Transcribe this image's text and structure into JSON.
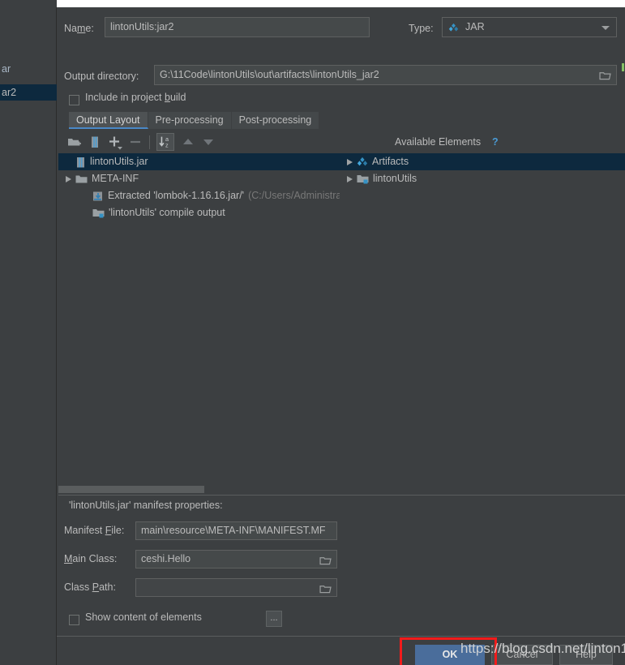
{
  "left_pane": {
    "items": [
      {
        "label": "ar",
        "selected": false
      },
      {
        "label": "ar2",
        "selected": true
      }
    ]
  },
  "form": {
    "name_label": "Name:",
    "name_value": "lintonUtils:jar2",
    "type_label": "Type:",
    "type_value": "JAR",
    "type_icon": "artifact-diamond-icon",
    "output_dir_label": "Output directory:",
    "output_dir_value": "G:\\11Code\\lintonUtils\\out\\artifacts\\lintonUtils_jar2",
    "include_in_build_label": "Include in project build",
    "include_in_build_checked": false
  },
  "tabs": [
    {
      "label": "Output Layout",
      "active": true
    },
    {
      "label": "Pre-processing",
      "active": false
    },
    {
      "label": "Post-processing",
      "active": false
    }
  ],
  "toolbar": {
    "buttons": [
      {
        "name": "add-directory-icon",
        "enabled": true
      },
      {
        "name": "add-archive-icon",
        "enabled": true
      },
      {
        "name": "add-plus-dropdown-icon",
        "enabled": true
      },
      {
        "name": "remove-minus-icon",
        "enabled": false
      },
      {
        "name": "sort-alphabetically-icon",
        "enabled": true,
        "boxed": true
      },
      {
        "name": "move-up-icon",
        "enabled": false
      },
      {
        "name": "move-down-icon",
        "enabled": false
      }
    ]
  },
  "available_elements": {
    "title": "Available Elements",
    "help_glyph": "?"
  },
  "output_tree": [
    {
      "label": "lintonUtils.jar",
      "sub": "",
      "indent": 0,
      "icon": "jar-archive-icon",
      "arrow": false,
      "selected": true
    },
    {
      "label": "META-INF",
      "sub": "",
      "indent": 0,
      "icon": "folder-icon",
      "arrow": true,
      "selected": false
    },
    {
      "label": "Extracted 'lombok-1.16.16.jar/'",
      "sub": "(C:/Users/Administrat",
      "indent": 1,
      "icon": "extracted-archive-icon",
      "arrow": false,
      "selected": false
    },
    {
      "label": "'lintonUtils' compile output",
      "sub": "",
      "indent": 1,
      "icon": "module-output-icon",
      "arrow": false,
      "selected": false
    }
  ],
  "available_tree": [
    {
      "label": "Artifacts",
      "indent": 0,
      "icon": "artifact-diamond-icon",
      "arrow": true,
      "selected": true
    },
    {
      "label": "lintonUtils",
      "indent": 0,
      "icon": "module-output-icon",
      "arrow": true,
      "selected": false
    }
  ],
  "manifest": {
    "title": "'lintonUtils.jar' manifest properties:",
    "fields": [
      {
        "label": "Manifest File:",
        "value": "main\\resource\\META-INF\\MANIFEST.MF",
        "has_browse": false
      },
      {
        "label": "Main Class:",
        "value": "ceshi.Hello",
        "has_browse": true
      },
      {
        "label": "Class Path:",
        "value": "",
        "has_browse": true
      }
    ],
    "show_content_label": "Show content of elements",
    "show_content_checked": false,
    "ellipsis_label": "..."
  },
  "buttons": {
    "ok": "OK",
    "cancel": "Cancel",
    "help": "Help"
  },
  "annotation": {
    "watermark": "https://blog.csdn.net/linton1",
    "highlight_color": "#f21b1b"
  },
  "colors": {
    "background": "#3c3f41",
    "field": "#45494a",
    "selection": "#0d293e",
    "text": "#bbbbbb",
    "accent": "#4a88c7",
    "primary_button": "#4a6d9b",
    "link": "#4a9ad4"
  }
}
